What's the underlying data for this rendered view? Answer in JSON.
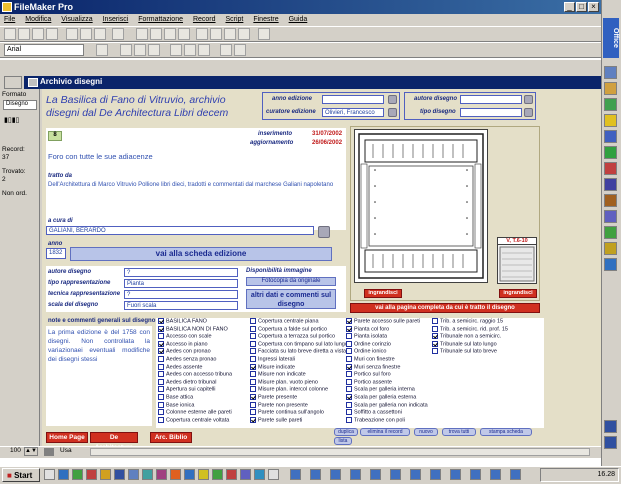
{
  "window": {
    "title": "FileMaker Pro"
  },
  "menu": [
    "File",
    "Modifica",
    "Visualizza",
    "Inserisci",
    "Formattazione",
    "Record",
    "Script",
    "Finestre",
    "Guida"
  ],
  "font_box": "Arial",
  "office_bar": {
    "label": "Office"
  },
  "document": {
    "title": "Archivio disegni"
  },
  "status_panel": {
    "layout_label": "Formato",
    "layout_name": "Disegno",
    "record_label": "Record:",
    "record_value": "37",
    "found_label": "Trovato:",
    "found_value": "2",
    "sort_label": "Non ord."
  },
  "record": {
    "title": "La Basilica di Fano di Vitruvio, archivio disegni dal De Architectura Libri decem",
    "anno_edizione_label": "anno edizione",
    "anno_edizione_value": "",
    "curatore_label": "curatore edizione",
    "curatore_value": "Olivieri, Francesco",
    "autore_label": "autore disegno",
    "autore_value": "",
    "tipo_label": "tipo disegno",
    "tipo_value": "",
    "id_value": "8",
    "inserimento_label": "inserimento",
    "inserimento_value": "31/07/2002",
    "aggiornamento_label": "aggiornamento",
    "aggiornamento_value": "26/06/2002",
    "description": "Foro con tutte le sue adiacenze",
    "tratto_da_label": "tratto da",
    "tratto_da_value": "Dell'Architettura di Marco Vitruvio Pollione libri dieci, tradotti e commentati dal marchese Galiani napoletano",
    "a_cura_di_label": "a cura di",
    "a_cura_di_value": "GALIANI, BERARDO",
    "anno_label": "anno",
    "anno_value": "1832",
    "scheda_edizione_button": "vai alla scheda edizione",
    "autore_disegno_label": "autore disegno",
    "autore_disegno_value": "?",
    "tipo_rappresentazione_label": "tipo rappresentazione",
    "tipo_rappresentazione_value": "Pianta",
    "tecnica_label": "tecnica rappresentazione",
    "tecnica_value": "?",
    "scala_label": "scala del disegno",
    "scala_value": "Fuori scala",
    "disponibilita_label": "Disponibilità immagine",
    "disponibilita_value": "Fotocopia da originale",
    "altri_dati_button": "altri dati e commenti sul disegno",
    "note_label": "note e commenti generali sul disegno",
    "note_text": "La prima edizione è del 1758 con disegni. Non controllata la variazionaei eventuali modifiche dei disegni stessi",
    "ingrandisci_left": "ingrandisci",
    "ingrandisci_right": "ingrandisci",
    "thumb_label": "V, T.6-10",
    "vai_pagina_button": "vai alla pagina completa da cui è tratto il disegno"
  },
  "checklists": [
    {
      "items": [
        {
          "label": "BASILICA FANO",
          "on": true
        },
        {
          "label": "BASILICA NON DI FANO",
          "on": true
        },
        {
          "label": "Accesso con scale",
          "on": false
        },
        {
          "label": "Accesso in piano",
          "on": true
        },
        {
          "label": "Aedes con pronao",
          "on": true
        },
        {
          "label": "Aedes senza pronao",
          "on": false
        },
        {
          "label": "Aedes assente",
          "on": false
        },
        {
          "label": "Aedes con accesso tribuna",
          "on": false
        },
        {
          "label": "Aedes dietro tribunal",
          "on": false
        },
        {
          "label": "Apertura sui capitelli",
          "on": false
        },
        {
          "label": "Base attica",
          "on": false
        },
        {
          "label": "Base ionica",
          "on": false
        },
        {
          "label": "Colonne esterne alle pareti",
          "on": false
        },
        {
          "label": "Copertura centrale voltata",
          "on": false
        }
      ]
    },
    {
      "items": [
        {
          "label": "Copertura centrale piana",
          "on": false
        },
        {
          "label": "Copertura a falde sul portico",
          "on": false
        },
        {
          "label": "Copertura a terrazza sul portico",
          "on": false
        },
        {
          "label": "Copertura con timpano sul lato lungo",
          "on": false
        },
        {
          "label": "Facciata su lato breve diretta a vista",
          "on": false
        },
        {
          "label": "Ingressi laterali",
          "on": false
        },
        {
          "label": "Misure indicate",
          "on": true
        },
        {
          "label": "Misure non indicate",
          "on": false
        },
        {
          "label": "Misure plan. vuoto pieno",
          "on": false
        },
        {
          "label": "Misure plan. intercol colonne",
          "on": false
        },
        {
          "label": "Parete presente",
          "on": true
        },
        {
          "label": "Parete non presente",
          "on": false
        },
        {
          "label": "Parete continua sull'angolo",
          "on": false
        },
        {
          "label": "Parete sulle pareti",
          "on": true
        }
      ]
    },
    {
      "items": [
        {
          "label": "Parete accesso sulle pareti",
          "on": true
        },
        {
          "label": "Pianta col foro",
          "on": true
        },
        {
          "label": "Pianta isolata",
          "on": false
        },
        {
          "label": "Ordine corinzio",
          "on": false
        },
        {
          "label": "Ordine ionico",
          "on": false
        },
        {
          "label": "Muri con finestre",
          "on": false
        },
        {
          "label": "Muri senza finestre",
          "on": true
        },
        {
          "label": "Portico sul foro",
          "on": false
        },
        {
          "label": "Portico assente",
          "on": false
        },
        {
          "label": "Scala per galleria interna",
          "on": false
        },
        {
          "label": "Scala per galleria esterna",
          "on": true
        },
        {
          "label": "Scala per galleria non indicata",
          "on": false
        },
        {
          "label": "Soffitto a cassettoni",
          "on": false
        },
        {
          "label": "Trabeazione con poli",
          "on": false
        }
      ]
    },
    {
      "items": [
        {
          "label": "Trib. a semicirc. raggio 15",
          "on": false
        },
        {
          "label": "Trib. a semicirc. rid. prof. 15",
          "on": false
        },
        {
          "label": "Tribunale non a semicirc.",
          "on": true
        },
        {
          "label": "Tribunale sul lato lungo",
          "on": true
        },
        {
          "label": "Tribunale sul lato breve",
          "on": false
        }
      ]
    }
  ],
  "bottom_buttons": {
    "home": "Home Page",
    "de_arch": "De Architectura",
    "arc_biblio": "Arc. Biblio",
    "duplica": "duplica",
    "elimina": "elimina il record",
    "nuovo": "nuovo",
    "trova": "trova tutti",
    "stampa": "stampa scheda",
    "lista": "lista"
  },
  "bottom_bar": {
    "zoom": "100",
    "mode": "Usa"
  },
  "taskbar": {
    "start": "Start",
    "clock": "16.28"
  }
}
